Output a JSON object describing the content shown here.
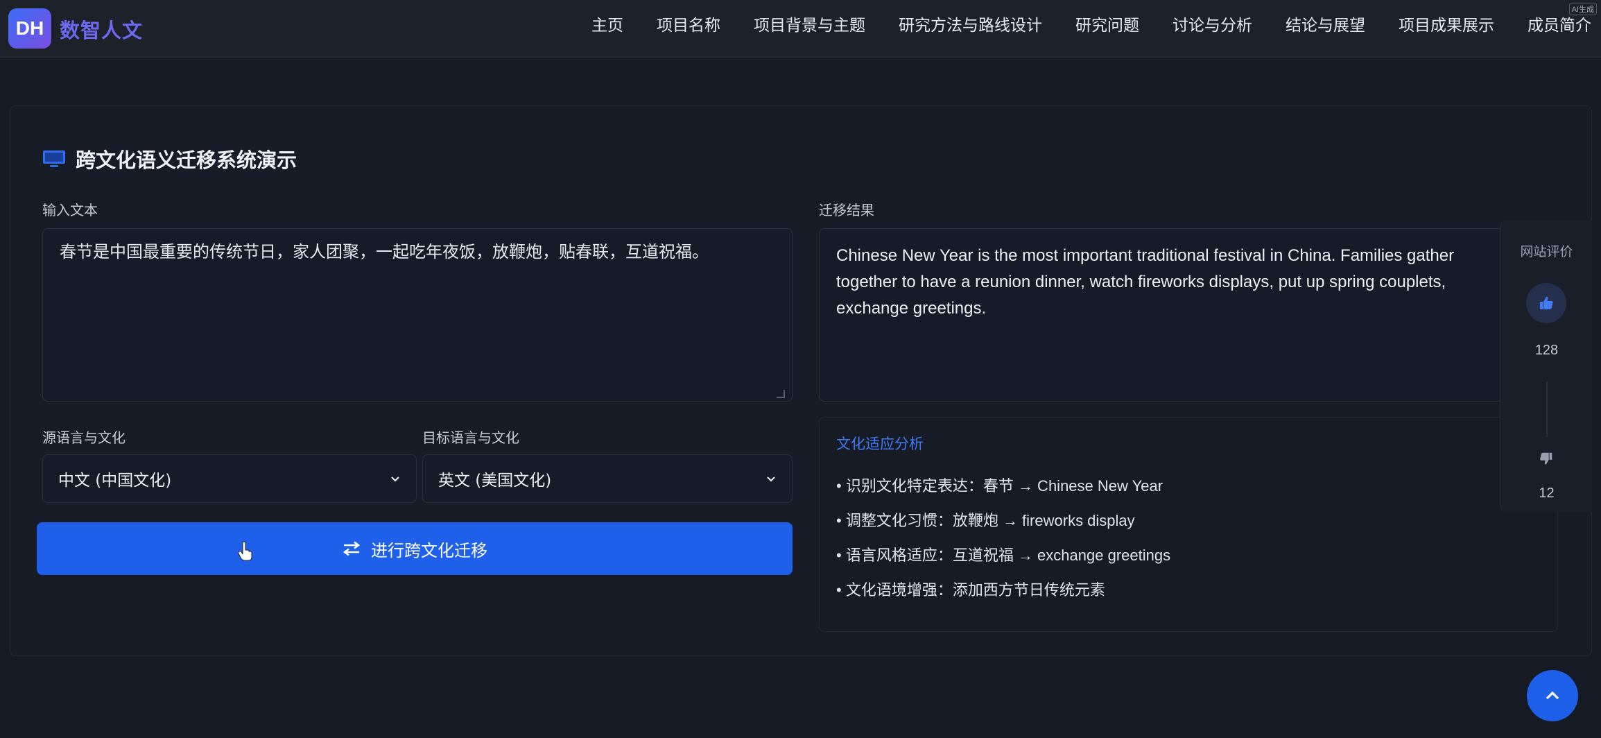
{
  "header": {
    "logo_badge": "DH",
    "logo_text": "数智人文",
    "nav": [
      {
        "label": "主页"
      },
      {
        "label": "项目名称"
      },
      {
        "label": "项目背景与主题"
      },
      {
        "label": "研究方法与路线设计"
      },
      {
        "label": "研究问题"
      },
      {
        "label": "讨论与分析"
      },
      {
        "label": "结论与展望"
      },
      {
        "label": "项目成果展示"
      },
      {
        "label": "成员简介"
      }
    ],
    "ai_tag": "AI生成"
  },
  "demo": {
    "title": "跨文化语义迁移系统演示",
    "input_label": "输入文本",
    "input_value": "春节是中国最重要的传统节日，家人团聚，一起吃年夜饭，放鞭炮，贴春联，互道祝福。",
    "source_label": "源语言与文化",
    "source_value": "中文 (中国文化)",
    "target_label": "目标语言与文化",
    "target_value": "英文 (美国文化)",
    "submit_label": "进行跨文化迁移",
    "result_label": "迁移结果",
    "result_value": "Chinese New Year is the most important traditional festival in China. Families gather together to have a reunion dinner, watch fireworks displays, put up spring couplets, exchange greetings.",
    "analysis_title": "文化适应分析",
    "analysis_items": [
      "识别文化特定表达：春节 → Chinese New Year",
      "调整文化习惯：放鞭炮 → fireworks display",
      "语言风格适应：互道祝福 → exchange greetings",
      "文化语境增强：添加西方节日传统元素"
    ]
  },
  "rating": {
    "title": "网站评价",
    "likes": "128",
    "dislikes": "12"
  },
  "colors": {
    "accent": "#1f60ea",
    "background": "#161a24",
    "analysis_title": "#3f7cf5"
  }
}
